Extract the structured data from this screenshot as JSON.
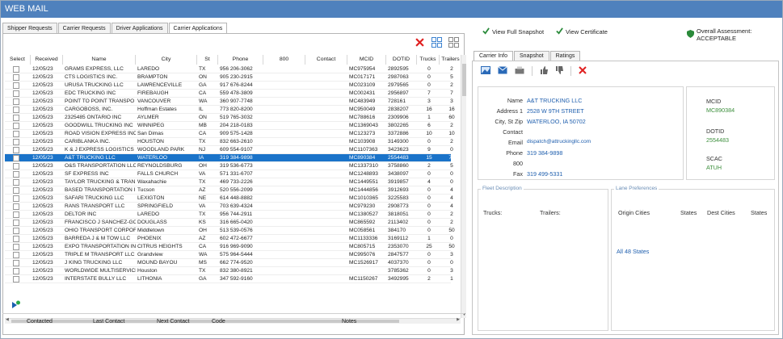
{
  "app": {
    "title": "WEB MAIL"
  },
  "tabs": [
    {
      "label": "Shipper Requests"
    },
    {
      "label": "Carrier Requests"
    },
    {
      "label": "Driver Applications"
    },
    {
      "label": "Carrier Applications"
    }
  ],
  "grid": {
    "headers": [
      "Select",
      "Received",
      "Name",
      "City",
      "St",
      "Phone",
      "800",
      "Contact",
      "MCID",
      "DOTID",
      "Trucks",
      "Trailers"
    ],
    "rows": [
      [
        "12/05/23",
        "GRAMS EXPRESS, LLC",
        "LAREDO",
        "TX",
        "956 206-3062",
        "",
        "",
        "MC975954",
        "2892595",
        "0",
        "2"
      ],
      [
        "12/05/23",
        "CTS LOGISTICS INC.",
        "BRAMPTON",
        "ON",
        "905 230-2915",
        "",
        "",
        "MC017171",
        "2987063",
        "0",
        "5"
      ],
      [
        "12/05/23",
        "URUSA TRUCKING LLC",
        "LAWRENCEVILLE",
        "GA",
        "917 676-8244",
        "",
        "",
        "MC023109",
        "2979565",
        "0",
        "2"
      ],
      [
        "12/05/23",
        "EDC TRUCKING INC",
        "FIREBAUGH",
        "CA",
        "559 478-3809",
        "",
        "",
        "MC002431",
        "2956897",
        "7",
        "7"
      ],
      [
        "12/05/23",
        "POINT TO POINT TRANSPO",
        "VANCOUVER",
        "WA",
        "360 907-7748",
        "",
        "",
        "MC483949",
        "728161",
        "3",
        "3"
      ],
      [
        "12/05/23",
        "CARGOBOSS, INC.",
        "Hoffman Estates",
        "IL",
        "773 820-8200",
        "",
        "",
        "MC950049",
        "2838207",
        "16",
        "16"
      ],
      [
        "12/05/23",
        "2325485 ONTARIO INC",
        "AYLMER",
        "ON",
        "519 765-3032",
        "",
        "",
        "MC788616",
        "2309906",
        "1",
        "60"
      ],
      [
        "12/05/23",
        "GOODWILL TRUCKING INC",
        "WINNIPEG",
        "MB",
        "204 218-0183",
        "",
        "",
        "MC1369043",
        "3802265",
        "6",
        "2"
      ],
      [
        "12/05/23",
        "ROAD VISION EXPRESS INC",
        "San Dimas",
        "CA",
        "909 575-1428",
        "",
        "",
        "MC123273",
        "3372886",
        "10",
        "10"
      ],
      [
        "12/05/23",
        "CARIBLANKA INC.",
        "HOUSTON",
        "TX",
        "832 663-2610",
        "",
        "",
        "MC103908",
        "3149300",
        "0",
        "2"
      ],
      [
        "12/05/23",
        "K & J EXPRESS LOGISTICS L",
        "WOODLAND PARK",
        "NJ",
        "609 554-9107",
        "",
        "",
        "MC1107363",
        "3423623",
        "9",
        "0"
      ],
      [
        "12/05/23",
        "A&T TRUCKING LLC",
        "WATERLOO",
        "IA",
        "319 384-9898",
        "",
        "",
        "MC890384",
        "2554483",
        "15",
        "70"
      ],
      [
        "12/05/23",
        "O&S TRANSPORTATION LLC",
        "REYNOLDSBURG",
        "OH",
        "319 536-6773",
        "",
        "",
        "MC1337310",
        "3758860",
        "2",
        "5"
      ],
      [
        "12/05/23",
        "SF EXPRESS INC",
        "FALLS CHURCH",
        "VA",
        "571 331-6707",
        "",
        "",
        "MC1248893",
        "3438097",
        "0",
        "0"
      ],
      [
        "12/05/23",
        "TAYLOR TRUCKING & TRAN",
        "Waxahachie",
        "TX",
        "469 733-2226",
        "",
        "",
        "MC1449551",
        "3919857",
        "4",
        "0"
      ],
      [
        "12/05/23",
        "BASED TRANSPORTATION I",
        "Tucson",
        "AZ",
        "520 556-2099",
        "",
        "",
        "MC1444856",
        "3912693",
        "0",
        "4"
      ],
      [
        "12/05/23",
        "SAFARI TRUCKING LLC",
        "LEXIGTON",
        "NE",
        "614 448-8882",
        "",
        "",
        "MC1010365",
        "3225583",
        "0",
        "4"
      ],
      [
        "12/05/23",
        "RANS TRANSPORT LLC",
        "SPRINGFIELD",
        "VA",
        "703 639-4324",
        "",
        "",
        "MC979230",
        "2908773",
        "0",
        "4"
      ],
      [
        "12/05/23",
        "DELTOR INC",
        "LAREDO",
        "TX",
        "956 744-2911",
        "",
        "",
        "MC1380527",
        "3818051",
        "0",
        "2"
      ],
      [
        "12/05/23",
        "FRANCISCO J SANCHEZ-GO",
        "DOUGLASS",
        "KS",
        "316 665-0420",
        "",
        "",
        "MC865592",
        "2113402",
        "0",
        "2"
      ],
      [
        "12/05/23",
        "OHIO TRANSPORT CORPOF",
        "Middletown",
        "OH",
        "513 539-0576",
        "",
        "",
        "MC058561",
        "384170",
        "0",
        "50"
      ],
      [
        "12/05/23",
        "BARREDA J & M TOW LLC",
        "PHOENIX",
        "AZ",
        "602 472-6677",
        "",
        "",
        "MC1133336",
        "3169112",
        "1",
        "0"
      ],
      [
        "12/05/23",
        "EXPO TRANSPORTATION IN",
        "CITRUS HEIGHTS",
        "CA",
        "916 969-9090",
        "",
        "",
        "MC805715",
        "2353070",
        "25",
        "50"
      ],
      [
        "12/05/23",
        "TRIPLE M TRANSPORT LLC",
        "Grandview",
        "WA",
        "575 964-5444",
        "",
        "",
        "MC995076",
        "2847577",
        "0",
        "3"
      ],
      [
        "12/05/23",
        "J KING TRUCKING LLC",
        "MOUND BAYOU",
        "MS",
        "662 774-9520",
        "",
        "",
        "MC1526917",
        "4037370",
        "0",
        "0"
      ],
      [
        "12/05/23",
        "WORLDWIDE MULTISERVICE",
        "Houston",
        "TX",
        "832 380-8921",
        "",
        "",
        "",
        "3785362",
        "0",
        "3"
      ],
      [
        "12/05/23",
        "INTERSTATE BULLY LLC",
        "LITHONIA",
        "GA",
        "347 592-9160",
        "",
        "",
        "MC1150267",
        "3492995",
        "2",
        "1"
      ]
    ],
    "selected_index": 11
  },
  "bottom": {
    "contacted": "Contacted",
    "last_contact": "Last Contact",
    "next_contact": "Next Contact",
    "code": "Code",
    "notes": "Notes"
  },
  "actions": {
    "view_snapshot": "View Full Snapshot",
    "view_certificate": "View Certificate",
    "overall": "Overall Assessment: ACCEPTABLE"
  },
  "right_tabs": [
    {
      "label": "Carrier Info"
    },
    {
      "label": "Snapshot"
    },
    {
      "label": "Ratings"
    }
  ],
  "carrier": {
    "name_label": "Name",
    "name": "A&T TRUCKING LLC",
    "address_label": "Address 1",
    "address": "2528 W 9TH STREET",
    "city_label": "City, St Zip",
    "city": "WATERLOO, IA  50702",
    "contact_label": "Contact",
    "contact": "",
    "email_label": "Email",
    "email": "dispatch@attruckingllc.com",
    "phone_label": "Phone",
    "phone": "319 384-9898",
    "p800_label": "800",
    "p800": "",
    "fax_label": "Fax",
    "fax": "319 499-5331",
    "mcid_label": "MCID",
    "mcid": "MC890384",
    "dotid_label": "DOTID",
    "dotid": "2554483",
    "scac_label": "SCAC",
    "scac": "ATUH"
  },
  "fleet": {
    "title": "Fleet Description",
    "trucks_label": "Trucks:",
    "trailers_label": "Trailers:"
  },
  "lanes": {
    "title": "Lane Preferences",
    "origin_label": "Origin Cities",
    "states_label": "States",
    "dest_label": "Dest Cities",
    "states2_label": "States",
    "origin_value": "All 48 States"
  },
  "colors": {
    "titlebar": "#4f81bd",
    "selected_row": "#1a73c9",
    "link": "#1f5fae",
    "green": "#3d8f3d",
    "delete": "#e02020"
  }
}
